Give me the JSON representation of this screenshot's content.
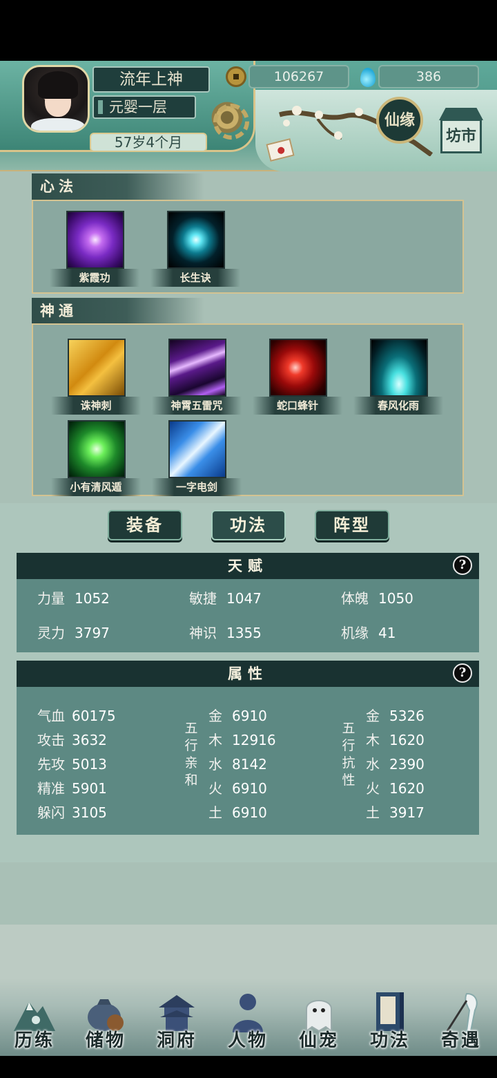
{
  "player": {
    "name": "流年上神",
    "realm": "元婴一层",
    "age": "57岁4个月"
  },
  "currency": {
    "coins": "106267",
    "spirit": "386"
  },
  "header": {
    "xianyuan_label": "仙缘",
    "fangshi_label": "坊市"
  },
  "xinfa": {
    "title": "心法",
    "items": [
      {
        "label": "紫霞功",
        "icon": "purple-vortex-icon"
      },
      {
        "label": "长生诀",
        "icon": "cyan-orb-icon"
      }
    ]
  },
  "shentong": {
    "title": "神通",
    "items": [
      {
        "label": "诛神刺",
        "icon": "spear-icon"
      },
      {
        "label": "神霄五雷咒",
        "icon": "lightning-icon"
      },
      {
        "label": "蛇口蜂针",
        "icon": "red-needle-icon"
      },
      {
        "label": "春风化雨",
        "icon": "cyan-rain-icon"
      },
      {
        "label": "小有清风遁",
        "icon": "green-wind-icon"
      },
      {
        "label": "一字电剑",
        "icon": "blue-sword-icon"
      }
    ]
  },
  "tabs": [
    {
      "label": "装备"
    },
    {
      "label": "功法"
    },
    {
      "label": "阵型"
    }
  ],
  "tianfu": {
    "title": "天赋",
    "help": "?",
    "stats": [
      {
        "label": "力量",
        "value": "1052"
      },
      {
        "label": "敏捷",
        "value": "1047"
      },
      {
        "label": "体魄",
        "value": "1050"
      },
      {
        "label": "灵力",
        "value": "3797"
      },
      {
        "label": "神识",
        "value": "1355"
      },
      {
        "label": "机缘",
        "value": "41"
      }
    ]
  },
  "shuxing": {
    "title": "属性",
    "help": "?",
    "basic": [
      {
        "label": "气血",
        "value": "60175"
      },
      {
        "label": "攻击",
        "value": "3632"
      },
      {
        "label": "先攻",
        "value": "5013"
      },
      {
        "label": "精准",
        "value": "5901"
      },
      {
        "label": "躲闪",
        "value": "3105"
      }
    ],
    "affinity_title": "五行亲和",
    "affinity": [
      {
        "label": "金",
        "value": "6910"
      },
      {
        "label": "木",
        "value": "12916"
      },
      {
        "label": "水",
        "value": "8142"
      },
      {
        "label": "火",
        "value": "6910"
      },
      {
        "label": "土",
        "value": "6910"
      }
    ],
    "resist_title": "五行抗性",
    "resist": [
      {
        "label": "金",
        "value": "5326"
      },
      {
        "label": "木",
        "value": "1620"
      },
      {
        "label": "水",
        "value": "2390"
      },
      {
        "label": "火",
        "value": "1620"
      },
      {
        "label": "土",
        "value": "3917"
      }
    ]
  },
  "nav": [
    {
      "label": "历练"
    },
    {
      "label": "储物"
    },
    {
      "label": "洞府"
    },
    {
      "label": "人物"
    },
    {
      "label": "仙宠"
    },
    {
      "label": "功法"
    },
    {
      "label": "奇遇"
    }
  ]
}
